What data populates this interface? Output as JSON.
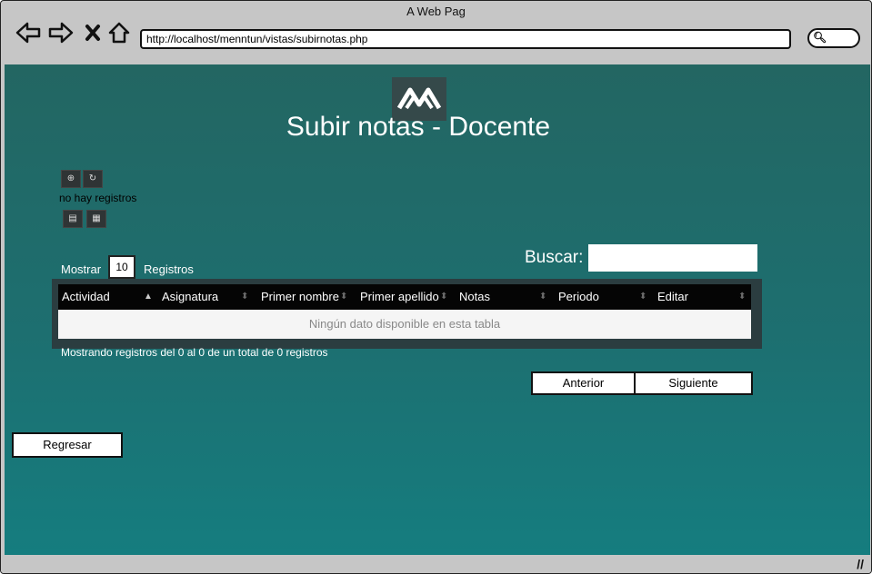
{
  "window": {
    "title": "A Web Pag"
  },
  "browser": {
    "url": "http://localhost/menntun/vistas/subirnotas.php",
    "back_icon": "back-arrow-icon",
    "forward_icon": "forward-arrow-icon",
    "close_icon": "close-icon",
    "home_icon": "home-icon"
  },
  "page": {
    "title": "Subir notas - Docente",
    "logo_icon": "menntun-logo",
    "no_records_text": "no hay registros",
    "show_label": "Mostrar",
    "page_length": "10",
    "records_label": "Registros",
    "search_label": "Buscar:",
    "search_value": ""
  },
  "table": {
    "columns": [
      "Actividad",
      "Asignatura",
      "Primer nombre",
      "Primer apellido",
      "Notas",
      "Periodo",
      "Editar"
    ],
    "empty_text": "Ningún dato disponible en esta tabla",
    "info_text": "Mostrando registros del 0 al 0 de un total de 0 registros"
  },
  "pagination": {
    "prev_label": "Anterior",
    "next_label": "Siguiente"
  },
  "back_button": {
    "label": "Regresar"
  },
  "colors": {
    "content_top": "#236662",
    "content_bottom": "#157d7f",
    "table_header": "#050505"
  }
}
